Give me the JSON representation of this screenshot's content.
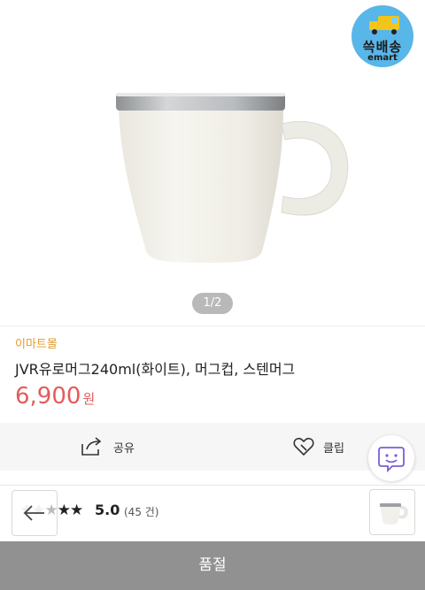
{
  "badge": {
    "line1": "쓱배송",
    "line2": "emart"
  },
  "gallery": {
    "pager": "1/2"
  },
  "product": {
    "seller": "이마트몰",
    "title": "JVR유로머그240ml(화이트), 머그컵, 스텐머그",
    "price": "6,900",
    "currency": "원"
  },
  "actions": {
    "share_label": "공유",
    "clip_label": "클립"
  },
  "review": {
    "rating": "5.0",
    "count": "(45 건)"
  },
  "footer": {
    "button_label": "품절"
  },
  "colors": {
    "price": "#e45b5b",
    "seller": "#e29b2c",
    "soldout_bg": "#919191",
    "badge_bg": "#58b6e8"
  }
}
